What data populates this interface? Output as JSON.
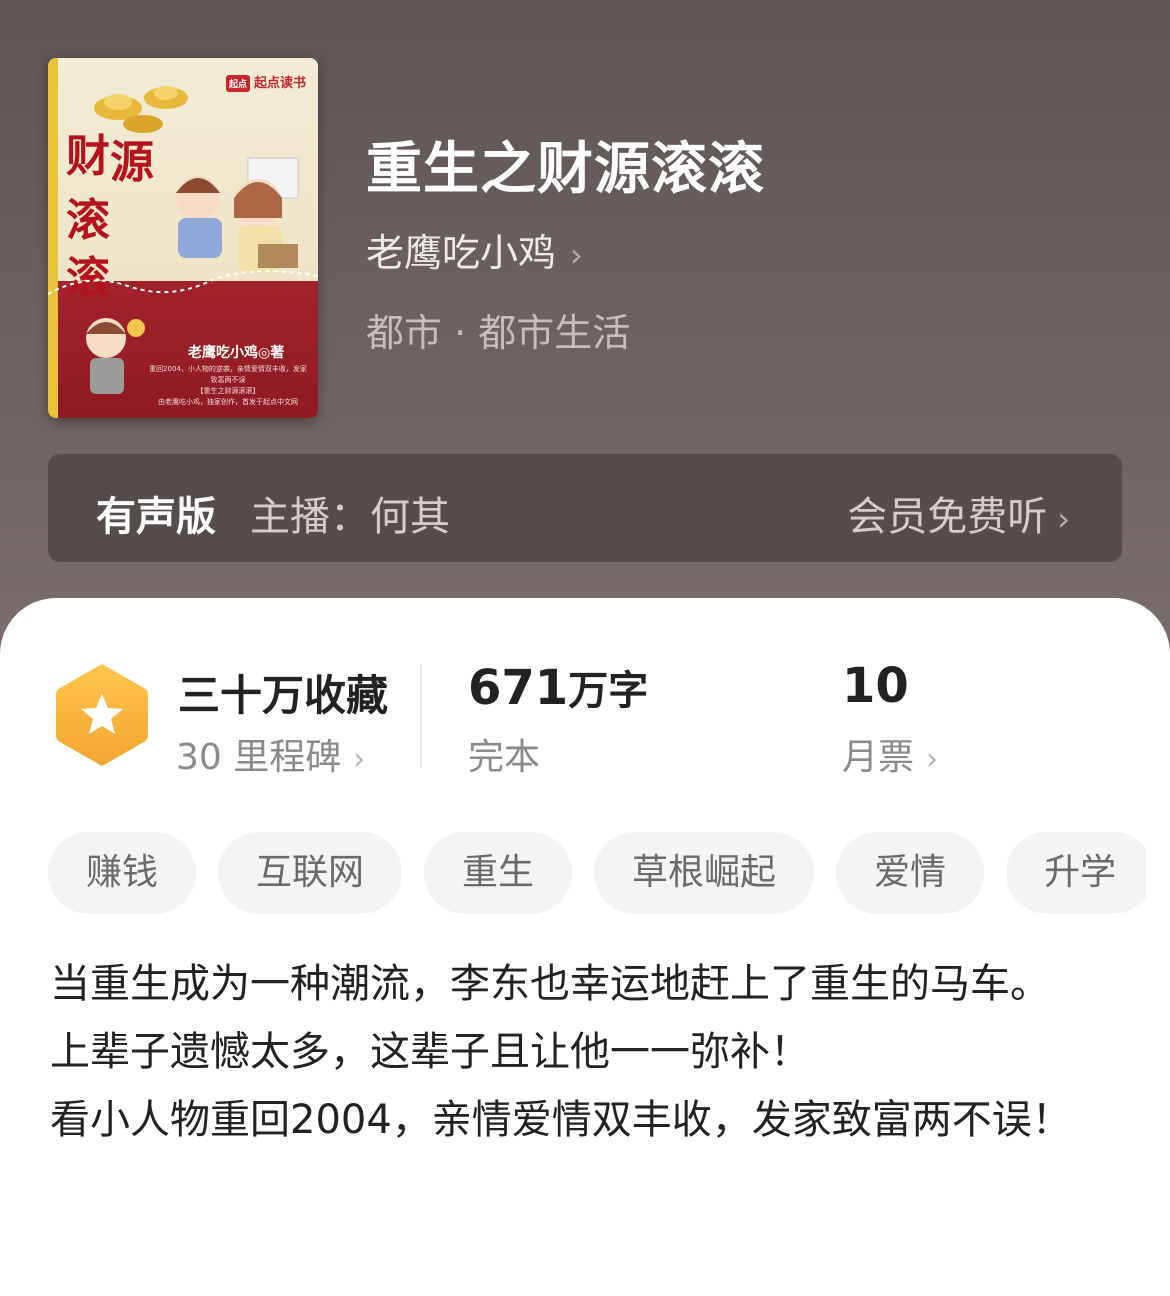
{
  "book": {
    "title": "重生之财源滚滚",
    "author": "老鹰吃小鸡",
    "category": "都市 · 都市生活"
  },
  "cover": {
    "publisher_logo": "起点读书",
    "logo_mark": "起点",
    "cover_title_a": "财",
    "cover_title_b": "源",
    "cover_title_c": "滚",
    "cover_title_d": "滚",
    "cover_author": "老鹰吃小鸡◎著",
    "cover_blurb_1": "重回2004，小人物的逆袭，亲情爱情双丰收，发家致富两不误",
    "cover_blurb_2": "【重生之财源滚滚】",
    "cover_blurb_3": "由老鹰吃小鸡，独家创作，首发于起点中文网"
  },
  "audio": {
    "label": "有声版",
    "narrator": "主播：何其",
    "vip_listen": "会员免费听"
  },
  "stats": {
    "collect_main": "三十万收藏",
    "collect_sub": "30 里程碑",
    "words_number": "671",
    "words_unit": "万字",
    "words_sub": "完本",
    "votes_main": "10",
    "votes_sub": "月票"
  },
  "tags": [
    "赚钱",
    "互联网",
    "重生",
    "草根崛起",
    "爱情",
    "升学"
  ],
  "synopsis": {
    "line1": "当重生成为一种潮流，李东也幸运地赶上了重生的马车。",
    "line2": "上辈子遗憾太多，这辈子且让他一一弥补！",
    "line3": "看小人物重回2004，亲情爱情双丰收，发家致富两不误！"
  },
  "colors": {
    "header_bg": "#6a5f5e",
    "badge_orange": "#f7b640",
    "cover_red": "#a3222a"
  },
  "icons": {
    "chevron": "chevron-right-icon",
    "badge": "star-hexagon-badge-icon"
  }
}
